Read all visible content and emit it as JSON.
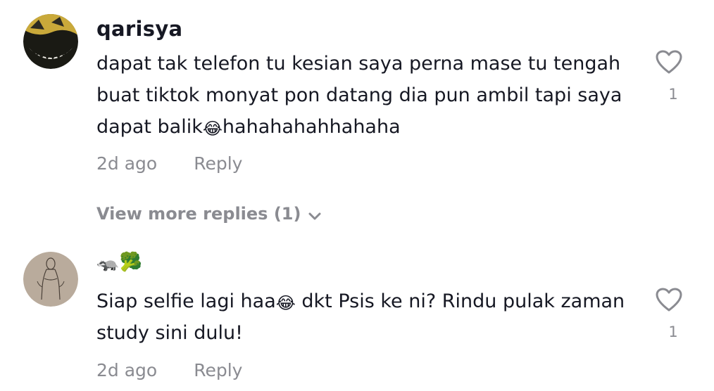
{
  "comments": [
    {
      "username": "qarisya",
      "text_before": "dapat tak telefon tu kesian saya perna mase tu tengah buat tiktok monyat pon datang dia pun ambil tapi saya dapat balik",
      "emoji": "😂",
      "text_after": "hahahahahhahaha",
      "time": "2d ago",
      "reply_label": "Reply",
      "like_count": "1",
      "view_more": "View more replies (1)",
      "icon": "heart-outline-icon"
    },
    {
      "username": "🦡🥦",
      "text_before": "Siap selfie lagi haa",
      "emoji": "😂",
      "text_after": " dkt Psis ke ni? Rindu pulak zaman study sini dulu!",
      "time": "2d ago",
      "reply_label": "Reply",
      "like_count": "1",
      "icon": "heart-outline-icon"
    }
  ],
  "colors": {
    "primary_text": "#161823",
    "secondary_text": "#8a8b91",
    "background": "#ffffff"
  }
}
